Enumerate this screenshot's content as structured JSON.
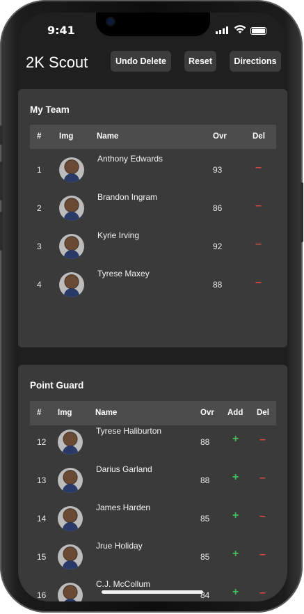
{
  "status": {
    "time": "9:41"
  },
  "header": {
    "title": "2K Scout",
    "undo_label": "Undo Delete",
    "reset_label": "Reset",
    "directions_label": "Directions"
  },
  "my_team": {
    "title": "My Team",
    "columns": {
      "num": "#",
      "img": "Img",
      "name": "Name",
      "ovr": "Ovr",
      "del": "Del"
    },
    "rows": [
      {
        "num": "1",
        "name": "Anthony Edwards",
        "ovr": "93",
        "del": "–"
      },
      {
        "num": "2",
        "name": "Brandon Ingram",
        "ovr": "86",
        "del": "–"
      },
      {
        "num": "3",
        "name": "Kyrie Irving",
        "ovr": "92",
        "del": "–"
      },
      {
        "num": "4",
        "name": "Tyrese Maxey",
        "ovr": "88",
        "del": "–"
      }
    ]
  },
  "point_guard": {
    "title": "Point Guard",
    "columns": {
      "num": "#",
      "img": "Img",
      "name": "Name",
      "ovr": "Ovr",
      "add": "Add",
      "del": "Del"
    },
    "rows": [
      {
        "num": "12",
        "name": "Tyrese Haliburton",
        "ovr": "88",
        "add": "+",
        "del": "–"
      },
      {
        "num": "13",
        "name": "Darius Garland",
        "ovr": "88",
        "add": "+",
        "del": "–"
      },
      {
        "num": "14",
        "name": "James Harden",
        "ovr": "85",
        "add": "+",
        "del": "–"
      },
      {
        "num": "15",
        "name": "Jrue Holiday",
        "ovr": "85",
        "add": "+",
        "del": "–"
      },
      {
        "num": "16",
        "name": "C.J. McCollum",
        "ovr": "84",
        "add": "+",
        "del": "–"
      }
    ]
  },
  "colors": {
    "add": "#3fbf5a",
    "del": "#d64a3f",
    "card": "#3a3a3a",
    "header_row": "#4c4c4c"
  }
}
